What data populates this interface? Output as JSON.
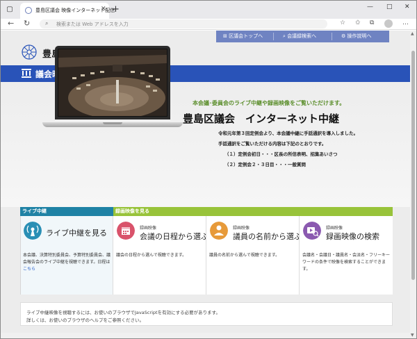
{
  "browser": {
    "tab_title": "豊島区議会 映像インターネット配信",
    "tab_close": "✕",
    "new_tab": "+",
    "address_placeholder": "検索または Web アドレスを入力",
    "window_minimize": "—",
    "window_maximize": "□",
    "window_close": "✕"
  },
  "topnav": {
    "items": [
      "区議会トップへ",
      "会議録検索へ",
      "操作説明へ"
    ]
  },
  "site": {
    "name": "豊島区議会",
    "banner_title": "議会映像インターネット配信"
  },
  "hero": {
    "subtitle": "本会議･委員会のライブ中継や録画映像をご覧いただけます。",
    "title": "豊島区議会　インターネット中継",
    "lines": [
      "令和元年第３回定例会より、本会議中継に手話通訳を導入しました。",
      "手話通訳をご覧いただける内容は下記のとおりです。",
      "（１）定例会初日・・・区長の所信表明、招集あいさつ",
      "（２）定例会２・３日目・・・一般質問"
    ]
  },
  "sections": {
    "live_label": "ライブ中継",
    "recorded_label": "録画映像を見る"
  },
  "cards": [
    {
      "small": "",
      "title": "ライブ中継を見る",
      "desc": "本会議、決算特別委員会、予算特別委員会、議会報告会のライブ中継を視聴できます。日程は",
      "link": "こちら",
      "color": "#2a8fb5"
    },
    {
      "small": "録画映像",
      "title": "会議の日程から選ぶ",
      "desc": "議会の日程から選んで視聴できます。",
      "color": "#d9536b"
    },
    {
      "small": "録画映像",
      "title": "議員の名前から選ぶ",
      "desc": "議員の名前から選んで視聴できます。",
      "color": "#e79a3a"
    },
    {
      "small": "録画映像",
      "title": "録画映像の検索",
      "desc": "会議名・会議日・議員名・会派名・フリーキーワードの条件で映像を検索することができます。",
      "color": "#8b5ab0"
    }
  ],
  "footer": {
    "lines": [
      "ライブ中継映像を視聴するには、お使いのブラウザでJavaScriptを有効にする必要があります。",
      "詳しくは、お使いのブラウザのヘルプをご参照ください。"
    ]
  }
}
